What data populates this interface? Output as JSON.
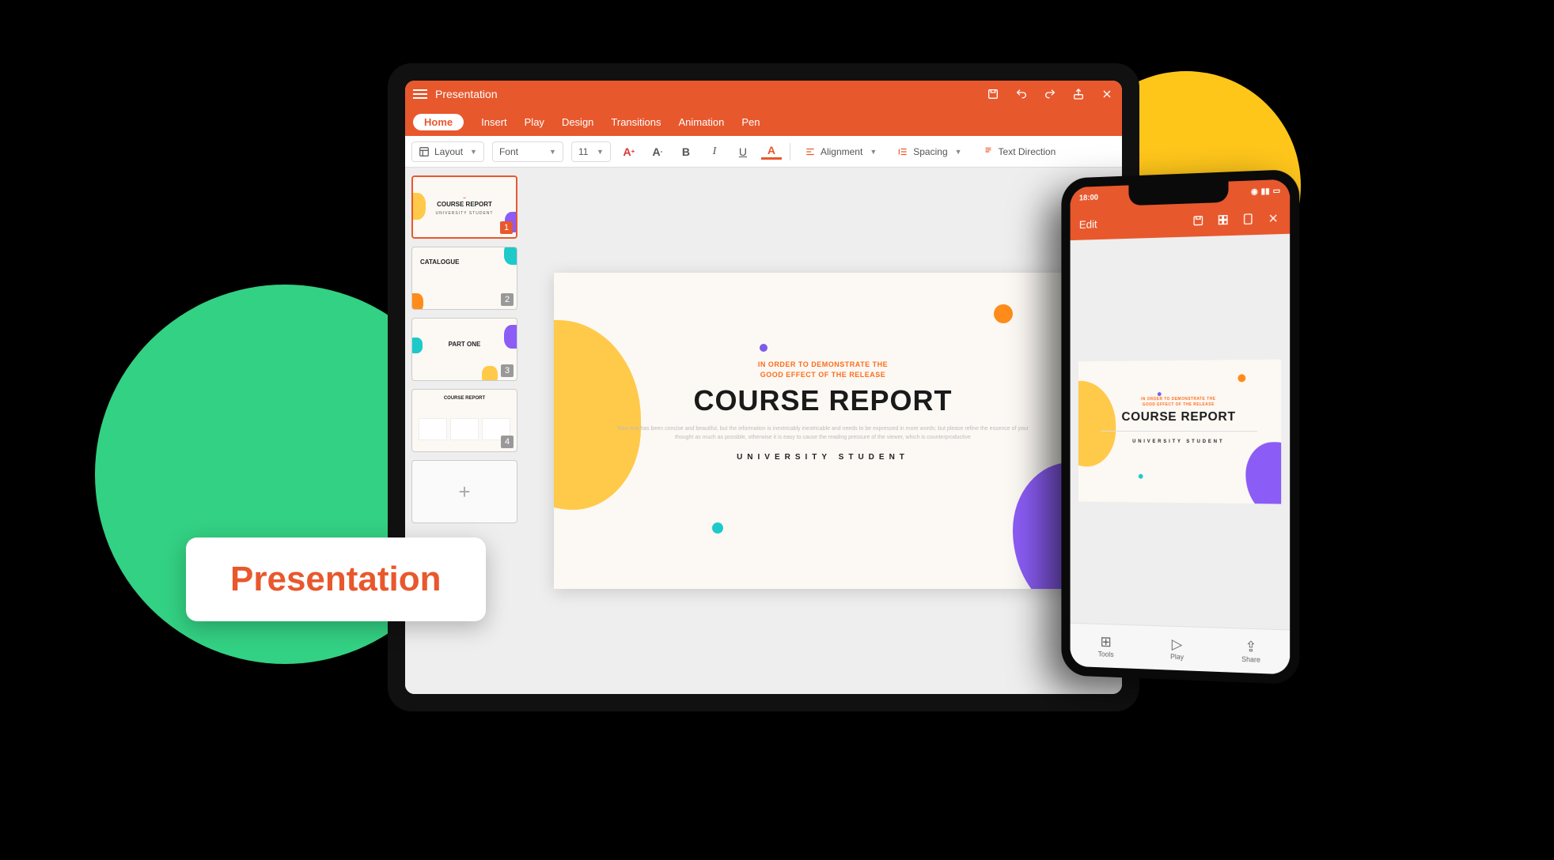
{
  "marketing_label": "Presentation",
  "colors": {
    "accent": "#e8582d",
    "green": "#33d183",
    "yellow": "#ffc61a",
    "purple": "#8b5cf6"
  },
  "tablet": {
    "title": "Presentation",
    "tabs": [
      "Home",
      "Insert",
      "Play",
      "Design",
      "Transitions",
      "Animation",
      "Pen"
    ],
    "active_tab": "Home",
    "toolbar": {
      "layout": "Layout",
      "font": "Font",
      "font_size": "11",
      "alignment": "Alignment",
      "spacing": "Spacing",
      "text_direction": "Text Direction"
    },
    "thumbnails": [
      {
        "num": "1",
        "title": "COURSE REPORT",
        "sub": "UNIVERSITY STUDENT"
      },
      {
        "num": "2",
        "title": "CATALOGUE",
        "sub": ""
      },
      {
        "num": "3",
        "title": "PART ONE",
        "sub": ""
      },
      {
        "num": "4",
        "title": "COURSE REPORT",
        "sub": ""
      }
    ],
    "slide": {
      "eyebrow_l1": "IN ORDER TO DEMONSTRATE THE",
      "eyebrow_l2": "GOOD EFFECT OF THE RELEASE",
      "title": "COURSE REPORT",
      "body": "Your text has been concise and beautiful, but the information is inextricably inextricable and needs to be expressed in more words; but please refine the essence of your thought as much as possible, otherwise it is easy to cause the reading pressure of the viewer, which is counterproductive",
      "footer": "UNIVERSITY STUDENT"
    }
  },
  "phone": {
    "status_time": "18:00",
    "edit_label": "Edit",
    "bottom": {
      "tools": "Tools",
      "play": "Play",
      "share": "Share"
    },
    "slide": {
      "eyebrow_l1": "IN ORDER TO DEMONSTRATE THE",
      "eyebrow_l2": "GOOD EFFECT OF THE RELEASE",
      "title": "COURSE REPORT",
      "footer": "UNIVERSITY STUDENT"
    }
  }
}
